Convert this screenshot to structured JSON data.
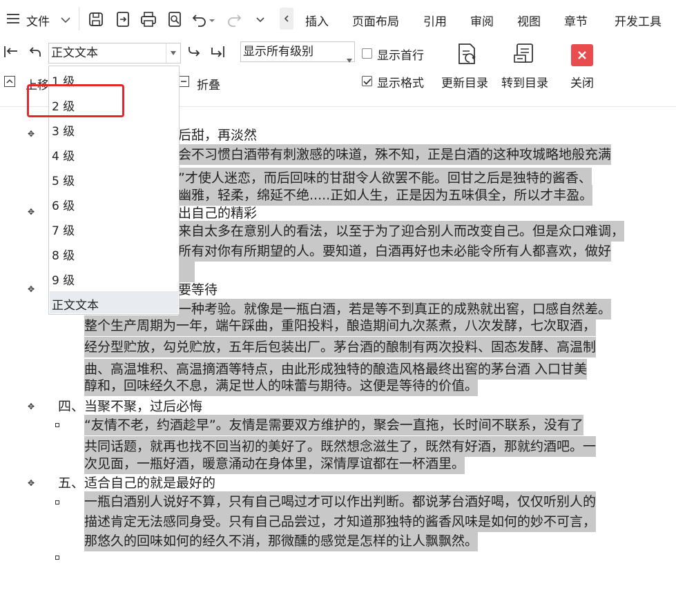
{
  "menu": {
    "file": "文件",
    "tabs": [
      "插入",
      "页面布局",
      "引用",
      "审阅",
      "视图",
      "章节",
      "开发工具"
    ]
  },
  "ribbon": {
    "level_select_value": "正文文本",
    "show_levels_select_value": "显示所有级别",
    "show_first_line": "显示首行",
    "show_format": "显示格式",
    "update_toc": "更新目录",
    "goto_toc": "转到目录",
    "close": "关闭",
    "move_up": "上移",
    "fold": "折叠",
    "show_first_line_checked": false,
    "show_format_checked": true
  },
  "dropdown": {
    "options": [
      "1 级",
      "2 级",
      "3 级",
      "4 级",
      "5 级",
      "6 级",
      "7 级",
      "8 级",
      "9 级",
      "正文文本"
    ],
    "selected": "正文文本"
  },
  "document": {
    "h1_tail": "后甜，再淡然",
    "p1_l1": "会不习惯白酒带有刺激感的味道，殊不知，正是白酒的这种攻城略地般充满",
    "p1_l2": "”才使人迷恋，而后回味的甘甜令人欲罢不能。回甘之后是独特的酱香、",
    "p1_l3": "幽雅，轻柔，绵延不绝.....正如人生，正是因为五味俱全，所以才丰盈。",
    "h2_tail": "出自己的精彩",
    "p2_l1": "来自太多在意别人的看法，以至于为了迎合别人而改变自己。但是众口难调，",
    "p2_l2": "所有对你有所期望的人。要知道，白酒再好也未必能令所有人都喜欢，做好",
    "h3_tail": "要等待",
    "p3_l1": "一种考验。就像是一瓶白酒，若是等不到真正的成熟就出窖，口感自然差。",
    "p3_l2": "整个生产周期为一年，端午踩曲，重阳投料，酿造期间九次蒸煮，八次发酵，七次取酒，",
    "p3_l3": "经分型贮放，勾兑贮放，五年后包装出厂。茅台酒的酿制有两次投料、固态发酵、高温制",
    "p3_l4": "曲、高温堆积、高温摘酒等特点，由此形成独特的酿造风格最终出窖的茅台酒 入口甘美",
    "p3_l5": "醇和，回味经久不息，满足世人的味蕾与期待。这便是等待的价值。",
    "h4": "四、当聚不聚，过后必悔",
    "p4_l1": "“友情不老，约酒趁早”。友情是需要双方维护的，聚会一直拖，长时间不联系，没有了",
    "p4_l2": "共同话题，就再也找不回当初的美好了。既然想念滋生了，既然有好酒，那就约酒吧。一",
    "p4_l3": "次见面，一瓶好酒，暖意涌动在身体里，深情厚谊都在一杯酒里。",
    "h5": "五、适合自己的就是最好的",
    "p5_l1": "一瓶白酒别人说好不算，只有自己喝过才可以作出判断。都说茅台酒好喝，仅仅听别人的",
    "p5_l2": "描述肯定无法感同身受。只有自己品尝过，才知道那独特的酱香风味是如何的妙不可言，",
    "p5_l3": "那悠久的回味如何的经久不消，那微醺的感觉是怎样的让人飘飘然。"
  },
  "colors": {
    "selection": "#c8c8c8",
    "highlight_box": "#e8242d",
    "close_icon_bg": "#e84c4f"
  }
}
